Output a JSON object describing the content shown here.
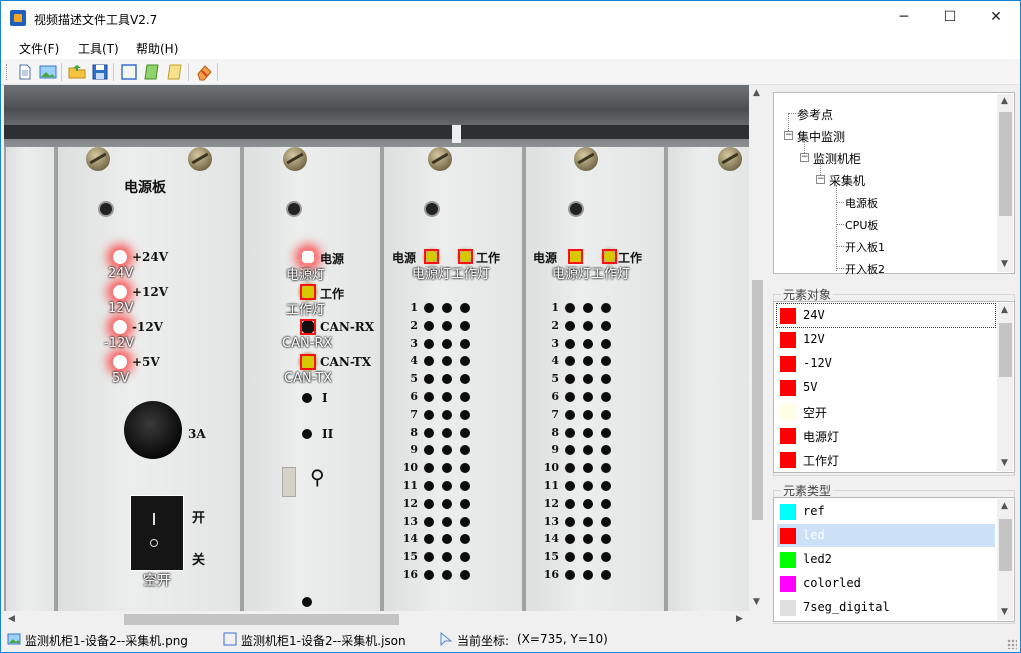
{
  "window": {
    "title": "视频描述文件工具V2.7",
    "controls": {
      "minimize": "─",
      "maximize": "☐",
      "close": "✕"
    }
  },
  "menu": {
    "file": "文件(F)",
    "tools": "工具(T)",
    "help": "帮助(H)"
  },
  "toolbar": {
    "icons": [
      "new-file-icon",
      "open-image-icon",
      "open-folder-icon",
      "save-icon",
      "rectangle-tool-icon",
      "green-note-icon",
      "yellow-note-icon",
      "eraser-icon"
    ]
  },
  "image": {
    "board_labels": {
      "power_board": "电源板",
      "p24": "+24V",
      "p12": "+12V",
      "n12": "-12V",
      "p5": "+5V",
      "fuse": "3A",
      "on": "开",
      "off": "关",
      "power": "电源",
      "work": "工作",
      "can_rx": "CAN-RX",
      "can_tx": "CAN-TX",
      "i": "I",
      "ii": "II",
      "power3": "电源",
      "work3": "工作",
      "power4": "电源",
      "work4": "工作"
    },
    "annotations": {
      "a24": "24V",
      "a12": "12V",
      "an12": "-12V",
      "a5": "5V",
      "breaker": "空开",
      "power_led": "电源灯",
      "work_led": "工作灯",
      "can_rx": "CAN-RX",
      "can_tx": "CAN-TX",
      "b3": "电源灯工作灯",
      "b4": "电源灯工作灯"
    },
    "row_numbers": [
      "1",
      "2",
      "3",
      "4",
      "5",
      "6",
      "7",
      "8",
      "9",
      "10",
      "11",
      "12",
      "13",
      "14",
      "15",
      "16"
    ]
  },
  "tree": {
    "nodes": [
      {
        "label": "参考点"
      },
      {
        "label": "集中监测",
        "expander": "−"
      },
      {
        "label": "监测机柜",
        "expander": "−"
      },
      {
        "label": "采集机",
        "expander": "−"
      },
      {
        "label": "电源板"
      },
      {
        "label": "CPU板"
      },
      {
        "label": "开入板1"
      },
      {
        "label": "开入板2"
      }
    ]
  },
  "elements": {
    "group_title": "元素对象",
    "items": [
      {
        "label": "24V",
        "color": "#ff0000"
      },
      {
        "label": "12V",
        "color": "#ff0000"
      },
      {
        "label": "-12V",
        "color": "#ff0000"
      },
      {
        "label": "5V",
        "color": "#ff0000"
      },
      {
        "label": "空开",
        "color": "#ffffe6"
      },
      {
        "label": "电源灯",
        "color": "#ff0000"
      },
      {
        "label": "工作灯",
        "color": "#ff0000"
      }
    ]
  },
  "types": {
    "group_title": "元素类型",
    "items": [
      {
        "label": "ref",
        "color": "#00ffff"
      },
      {
        "label": "led",
        "color": "#ff0000"
      },
      {
        "label": "led2",
        "color": "#00ff00"
      },
      {
        "label": "colorled",
        "color": "#ff00ff"
      },
      {
        "label": "7seg_digital",
        "color": "#e0e0e0"
      }
    ]
  },
  "status": {
    "image_file": "监测机柜1-设备2--采集机.png",
    "json_file": "监测机柜1-设备2--采集机.json",
    "coords_label": "当前坐标:",
    "coords_value": "(X=735, Y=10)"
  },
  "colors": {
    "accent": "#1883d7",
    "selection": "#cce0f7",
    "annotation_box": "#ff1010"
  }
}
